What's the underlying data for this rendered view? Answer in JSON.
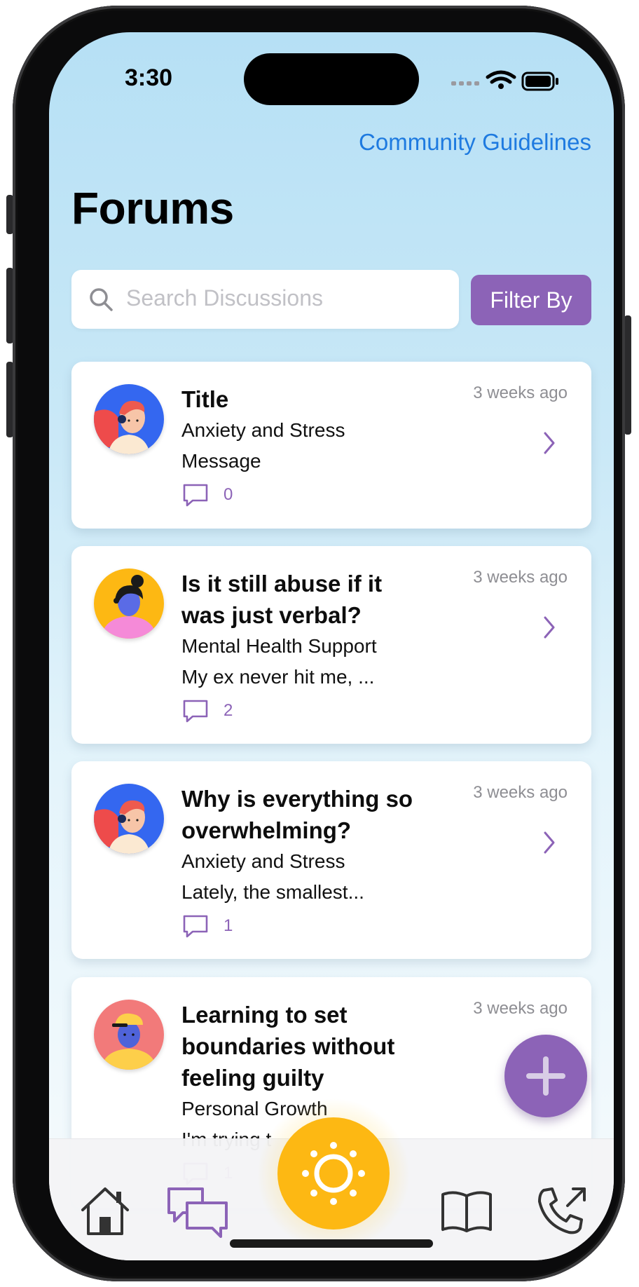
{
  "status_bar": {
    "time": "3:30"
  },
  "header": {
    "guidelines_link": "Community Guidelines",
    "title": "Forums"
  },
  "search": {
    "placeholder": "Search Discussions"
  },
  "filter": {
    "label": "Filter By"
  },
  "posts": [
    {
      "title": "Title",
      "time": "3 weeks ago",
      "category": "Anxiety and Stress",
      "message": "Message",
      "comments": "0",
      "avatar": "blue-headset-avatar"
    },
    {
      "title": "Is it still abuse if it was just verbal?",
      "time": "3 weeks ago",
      "category": "Mental Health Support",
      "message": "My ex never hit me, ...",
      "comments": "2",
      "avatar": "yellow-bun-avatar"
    },
    {
      "title": "Why is everything so overwhelming?",
      "time": "3 weeks ago",
      "category": "Anxiety and Stress",
      "message": "Lately, the smallest...",
      "comments": "1",
      "avatar": "blue-headset-avatar"
    },
    {
      "title": "Learning to set boundaries without feeling guilty",
      "time": "3 weeks ago",
      "category": "Personal Growth",
      "message": "I'm trying t",
      "comments": "1",
      "avatar": "cap-avatar"
    }
  ],
  "tabs": [
    {
      "icon": "home-icon"
    },
    {
      "icon": "forums-icon",
      "active": true
    },
    {
      "icon": "sun-icon"
    },
    {
      "icon": "book-icon"
    },
    {
      "icon": "phone-outgoing-icon"
    }
  ],
  "colors": {
    "accent": "#8c63b7",
    "link": "#1e7ae0",
    "sun": "#fdb813"
  }
}
